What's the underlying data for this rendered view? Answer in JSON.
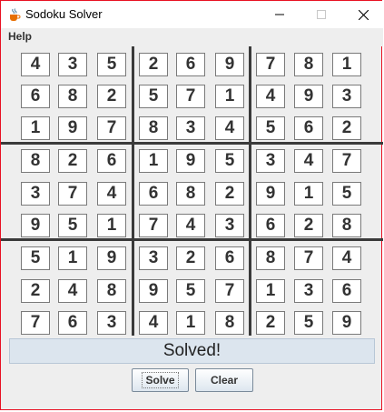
{
  "window": {
    "title": "Sodoku Solver"
  },
  "menu": {
    "help": "Help"
  },
  "grid": [
    [
      4,
      3,
      5,
      2,
      6,
      9,
      7,
      8,
      1
    ],
    [
      6,
      8,
      2,
      5,
      7,
      1,
      4,
      9,
      3
    ],
    [
      1,
      9,
      7,
      8,
      3,
      4,
      5,
      6,
      2
    ],
    [
      8,
      2,
      6,
      1,
      9,
      5,
      3,
      4,
      7
    ],
    [
      3,
      7,
      4,
      6,
      8,
      2,
      9,
      1,
      5
    ],
    [
      9,
      5,
      1,
      7,
      4,
      3,
      6,
      2,
      8
    ],
    [
      5,
      1,
      9,
      3,
      2,
      6,
      8,
      7,
      4
    ],
    [
      2,
      4,
      8,
      9,
      5,
      7,
      1,
      3,
      6
    ],
    [
      7,
      6,
      3,
      4,
      1,
      8,
      2,
      5,
      9
    ]
  ],
  "status": "Solved!",
  "buttons": {
    "solve": "Solve",
    "clear": "Clear"
  },
  "icons": {
    "app": "java-cup-icon",
    "minimize": "minimize-icon",
    "maximize": "maximize-icon",
    "close": "close-icon"
  }
}
